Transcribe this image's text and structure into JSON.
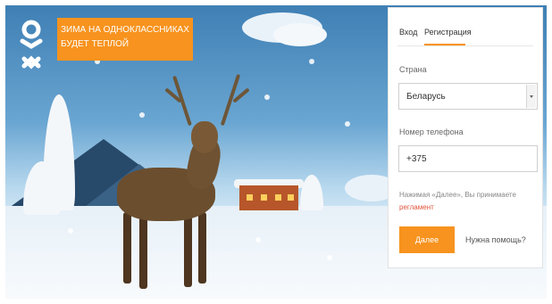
{
  "promo": {
    "line1": "ЗИМА НА ОДНОКЛАССНИКАХ",
    "line2": "БУДЕТ ТЕПЛОЙ"
  },
  "logo": {
    "icon": "ok-logo",
    "text": "ОК"
  },
  "auth": {
    "tabs": [
      {
        "label": "Вход",
        "active": false
      },
      {
        "label": "Регистрация",
        "active": true
      }
    ],
    "country_label": "Страна",
    "country_value": "Беларусь",
    "phone_label": "Номер телефона",
    "phone_value": "+375",
    "terms_text": "Нажимая «Далее», Вы принимаете",
    "terms_link": "регламент",
    "next_button": "Далее",
    "help_link": "Нужна помощь?"
  },
  "colors": {
    "accent": "#f7931e",
    "link": "#e0543a"
  }
}
